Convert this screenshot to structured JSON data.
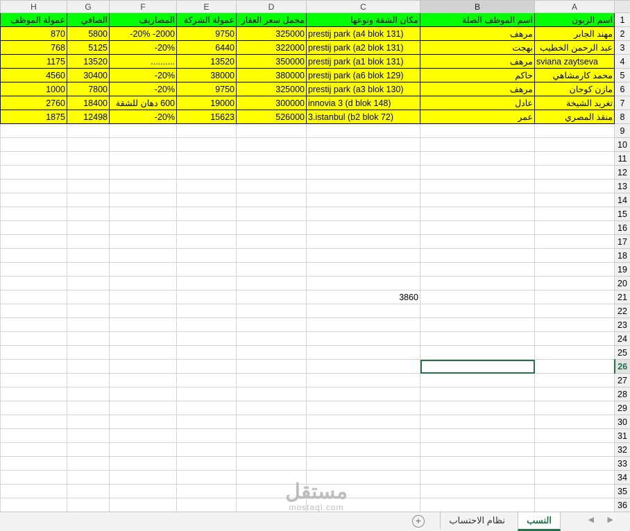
{
  "columns": [
    "H",
    "G",
    "F",
    "E",
    "D",
    "C",
    "B",
    "A"
  ],
  "selected_column": "B",
  "selected_row": 26,
  "header_row": [
    "عمولة الموظف",
    "الصافي",
    "المصاريف",
    "عمولة الشركة",
    "مجمل سعر العقار",
    "مكان الشقة ونوعها",
    "اسم الموظف الصلة",
    "اسم الزبون"
  ],
  "rows": [
    [
      "870",
      "5800",
      "2000- 20%-",
      "9750",
      "325000",
      "prestij park (a4 blok 131)",
      "مرهف",
      "مهند الجابر"
    ],
    [
      "768",
      "5125",
      "20%-",
      "6440",
      "322000",
      "prestij park (a2 blok 131)",
      "بهجت",
      "عبد الرحمن الخطيب"
    ],
    [
      "1175",
      "13520",
      "..........",
      "13520",
      "350000",
      "prestij park (a1 blok 131)",
      "مرهف",
      "sviana zaytseva"
    ],
    [
      "4560",
      "30400",
      "20%-",
      "38000",
      "380000",
      "prestij park (a6 blok 129)",
      "حاكم",
      "محمد كارمشاهي"
    ],
    [
      "1000",
      "7800",
      "20%-",
      "9750",
      "325000",
      "prestij park (a3 blok 130)",
      "مرهف",
      "مازن كوجان"
    ],
    [
      "2760",
      "18400",
      "600 دهان للشقة",
      "19000",
      "300000",
      "innovia 3 (d blok 148)",
      "عادل",
      "تغريد الشيخة"
    ],
    [
      "1875",
      "12498",
      "20%-",
      "15623",
      "526000",
      "3.istanbul (b2 blok 72)",
      "عمر",
      "منقذ المصري"
    ]
  ],
  "cell_c21": "3860",
  "row_numbers": [
    "1",
    "2",
    "3",
    "4",
    "5",
    "6",
    "7",
    "8",
    "9",
    "10",
    "11",
    "12",
    "13",
    "14",
    "15",
    "16",
    "17",
    "18",
    "19",
    "20",
    "21",
    "22",
    "23",
    "24",
    "25",
    "26",
    "27",
    "28",
    "29",
    "30",
    "31",
    "32",
    "33",
    "34",
    "35",
    "36"
  ],
  "tabs": {
    "active": "النسب",
    "second": "نظام الاحتساب"
  },
  "watermark": {
    "arabic": "مستقل",
    "latin": "mostaql.com"
  }
}
